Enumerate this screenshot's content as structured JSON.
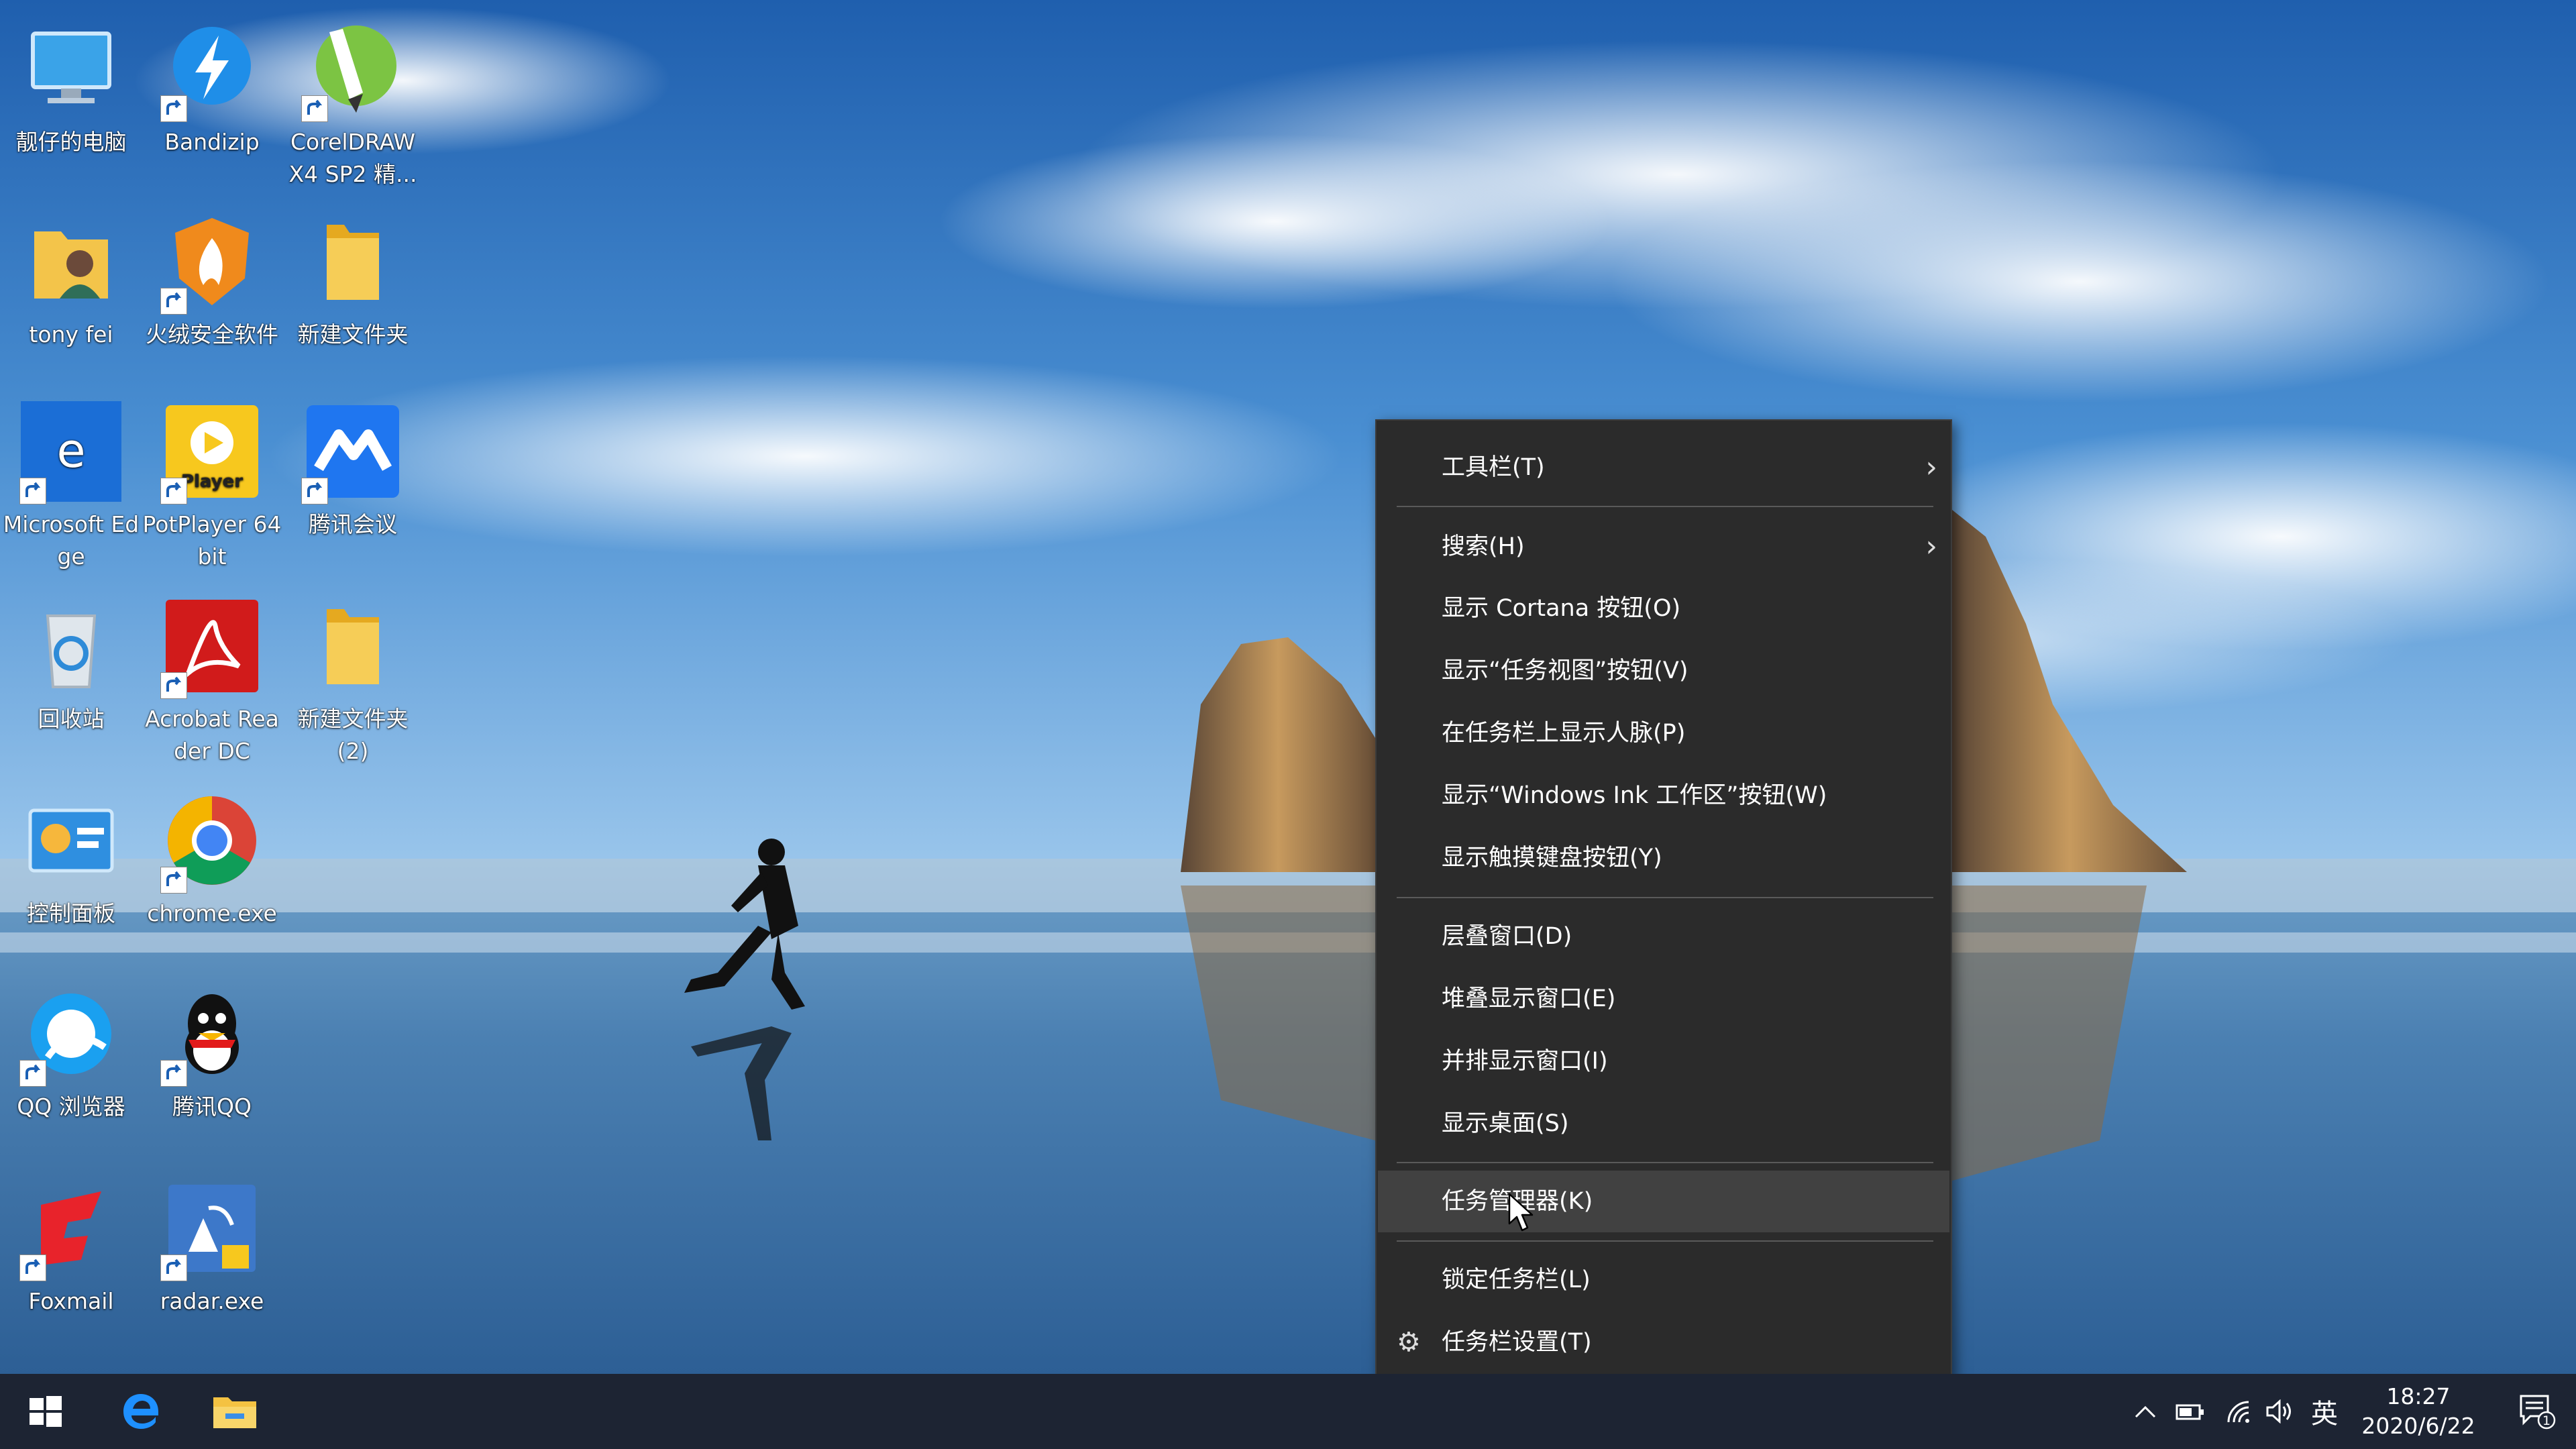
{
  "desktop": {
    "icons": [
      {
        "label": "靓仔的电脑",
        "icon": "computer-icon"
      },
      {
        "label": "Bandizip",
        "icon": "bandizip-icon"
      },
      {
        "label": "CorelDRAW X4 SP2 精...",
        "icon": "coreldraw-icon"
      },
      {
        "label": "tony fei",
        "icon": "user-folder-icon"
      },
      {
        "label": "火绒安全软件",
        "icon": "huorong-icon"
      },
      {
        "label": "新建文件夹",
        "icon": "folder-icon"
      },
      {
        "label": "Microsoft Edge",
        "icon": "edge-icon"
      },
      {
        "label": "PotPlayer 64 bit",
        "icon": "potplayer-icon"
      },
      {
        "label": "腾讯会议",
        "icon": "tencent-meeting-icon"
      },
      {
        "label": "回收站",
        "icon": "recycle-bin-icon"
      },
      {
        "label": "Acrobat Reader DC",
        "icon": "acrobat-icon"
      },
      {
        "label": "新建文件夹 (2)",
        "icon": "folder-icon"
      },
      {
        "label": "控制面板",
        "icon": "control-panel-icon"
      },
      {
        "label": "chrome.exe",
        "icon": "chrome-icon"
      },
      {
        "label": "QQ 浏览器",
        "icon": "qq-browser-icon"
      },
      {
        "label": "腾讯QQ",
        "icon": "qq-icon"
      },
      {
        "label": "Foxmail",
        "icon": "foxmail-icon"
      },
      {
        "label": "radar.exe",
        "icon": "radar-icon"
      }
    ]
  },
  "context_menu": {
    "items": {
      "toolbars": "工具栏(T)",
      "search": "搜索(H)",
      "show_cortana": "显示 Cortana 按钮(O)",
      "show_task_view": "显示“任务视图”按钮(V)",
      "show_people": "在任务栏上显示人脉(P)",
      "show_ink": "显示“Windows Ink 工作区”按钮(W)",
      "show_touch_keyboard": "显示触摸键盘按钮(Y)",
      "cascade": "层叠窗口(D)",
      "stacked": "堆叠显示窗口(E)",
      "side_by_side": "并排显示窗口(I)",
      "show_desktop": "显示桌面(S)",
      "task_manager": "任务管理器(K)",
      "lock_taskbar": "锁定任务栏(L)",
      "taskbar_settings": "任务栏设置(T)"
    },
    "submenu_glyph": "›",
    "gear_glyph": "⚙",
    "hovered": "task_manager"
  },
  "taskbar": {
    "pinned": [
      "start-icon",
      "edge-icon",
      "file-explorer-icon"
    ],
    "tray": {
      "chevron": "^",
      "ime": "英",
      "notification_count": "1"
    },
    "clock": {
      "time": "18:27",
      "date": "2020/6/22"
    }
  },
  "colors": {
    "menu_bg": "#2b2b2b",
    "menu_hover": "#414141",
    "taskbar_bg": "#1d2433"
  }
}
